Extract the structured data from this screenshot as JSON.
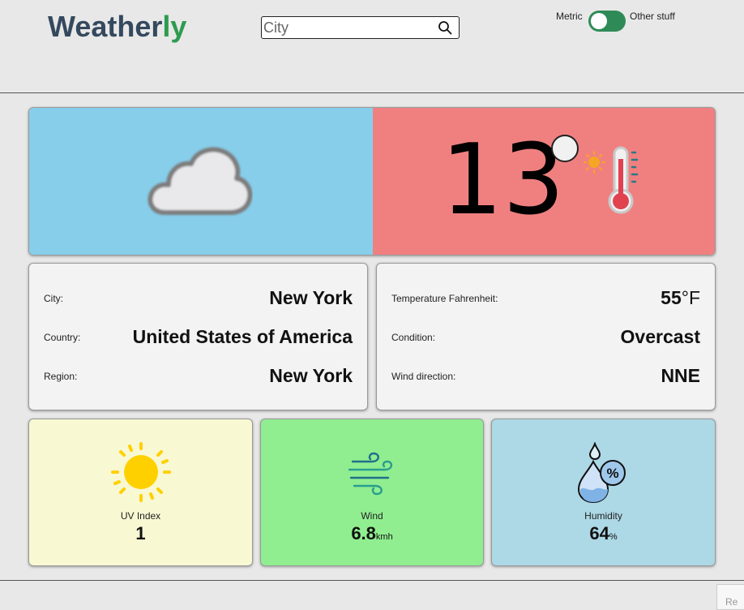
{
  "app": {
    "logo_main": "Weather",
    "logo_accent": "ly"
  },
  "search": {
    "placeholder": "City"
  },
  "units_toggle": {
    "left_label": "Metric",
    "right_label": "Other stuff",
    "on": true
  },
  "current": {
    "temperature": "13",
    "condition_icon": "cloud-icon"
  },
  "location": [
    {
      "label": "City:",
      "value": "New York"
    },
    {
      "label": "Country:",
      "value": "United States of America"
    },
    {
      "label": "Region:",
      "value": "New York"
    }
  ],
  "details": {
    "fahrenheit_label": "Temperature Fahrenheit:",
    "fahrenheit_value": "55",
    "fahrenheit_unit": "°F",
    "condition_label": "Condition:",
    "condition_value": "Overcast",
    "wind_dir_label": "Wind direction:",
    "wind_dir_value": "NNE"
  },
  "tiles": {
    "uv": {
      "label": "UV Index",
      "value": "1"
    },
    "wind": {
      "label": "Wind",
      "value": "6.8",
      "unit": "kmh"
    },
    "humidity": {
      "label": "Humidity",
      "value": "64",
      "unit": "%"
    }
  },
  "corner_partial": "Re",
  "colors": {
    "cloud_panel": "#87ceeb",
    "temp_panel": "#f08080",
    "uv_tile": "#f8f8d3",
    "wind_tile": "#90ee90",
    "humidity_tile": "#add8e6",
    "toggle_on": "#2e8b57",
    "logo_accent": "#2e9b4e"
  }
}
